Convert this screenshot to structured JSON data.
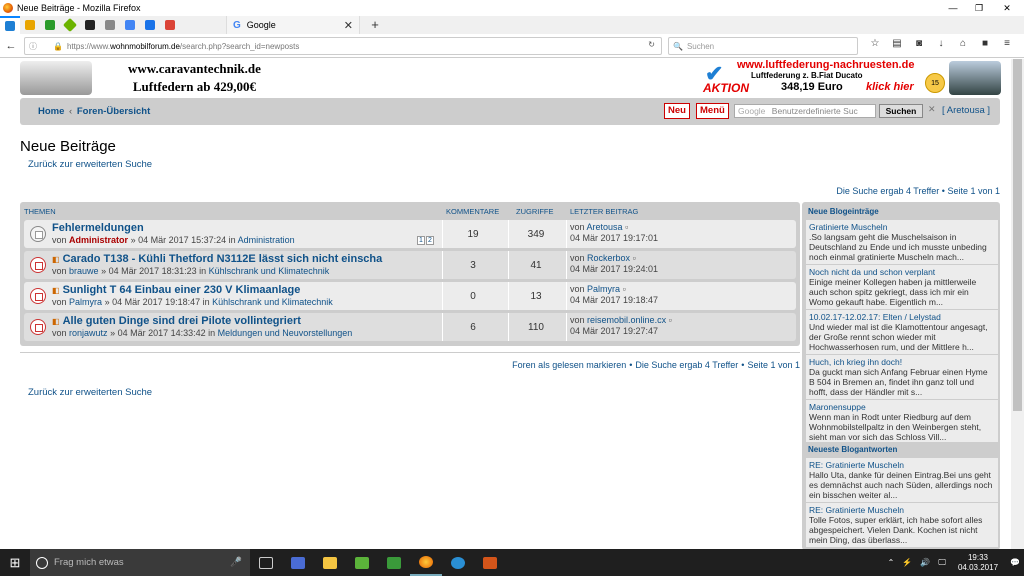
{
  "window": {
    "title": "Neue Beiträge - Mozilla Firefox",
    "min": "—",
    "max": "❐",
    "close": "✕"
  },
  "tabs": {
    "google_label": "Google",
    "google_icon": "G",
    "close": "✕",
    "new": "+"
  },
  "nav": {
    "back": "←",
    "info": "ⓘ",
    "lock": "🔒",
    "url_prefix": "https://www.",
    "url_domain": "wohnmobilforum.de",
    "url_path": "/search.php?search_id=newposts",
    "reload": "↻",
    "search_placeholder": "Suchen",
    "search_icon": "🔍",
    "toolbar_icons": [
      "☆",
      "▤",
      "◙",
      "↓",
      "⌂",
      "■",
      "≡"
    ]
  },
  "banner": {
    "left_line1": "www.caravantechnik.de",
    "left_line2": "Luftfedern ab 429,00€",
    "right_site": "www.luftfederung-nachruesten.de",
    "right_line2": "Luftfederung z. B.Fiat Ducato",
    "right_price": "348,19 Euro",
    "right_aktion": "AKTION",
    "right_klick": "klick hier",
    "right_badge": "15"
  },
  "forumnav": {
    "home": "Home",
    "sep": "‹",
    "overview": "Foren-Übersicht",
    "new_btn": "Neu",
    "menu_btn": "Menü",
    "search_google": "Google",
    "search_placeholder": "Benutzerdefinierte Suc",
    "search_btn": "Suchen",
    "clear": "✕",
    "user": "[ Aretousa ]"
  },
  "page": {
    "title": "Neue Beiträge",
    "back_link": "Zurück zur erweiterten Suche",
    "result_top": "Die Suche ergab 4 Treffer • Seite 1 von 1",
    "footer_mark": "Foren als gelesen markieren",
    "footer_dot": "•",
    "footer_result": "Die Suche ergab 4 Treffer",
    "footer_page": "Seite 1 von 1"
  },
  "table": {
    "headers": {
      "themen": "THEMEN",
      "kommentare": "KOMMENTARE",
      "zugriffe": "ZUGRIFFE",
      "letzter": "LETZTER BEITRAG"
    },
    "rows": [
      {
        "title": "Fehlermeldungen",
        "von": "von",
        "author": "Administrator",
        "date": "» 04 Mär 2017 15:37:24 in",
        "forum": "Administration",
        "pages": [
          "1",
          "2"
        ],
        "comments": "19",
        "views": "349",
        "last_von": "von",
        "last_author": "Aretousa",
        "last_date": "04 Mär 2017 19:17:01"
      },
      {
        "title": "Carado T138 - Kühli Thetford N3112E lässt sich nicht einscha",
        "von": "von",
        "author": "brauwe",
        "date": "» 04 Mär 2017 18:31:23 in",
        "forum": "Kühlschrank und Klimatechnik",
        "comments": "3",
        "views": "41",
        "last_von": "von",
        "last_author": "Rockerbox",
        "last_date": "04 Mär 2017 19:24:01"
      },
      {
        "title": "Sunlight T 64 Einbau einer 230 V Klimaanlage",
        "von": "von",
        "author": "Palmyra",
        "date": "» 04 Mär 2017 19:18:47 in",
        "forum": "Kühlschrank und Klimatechnik",
        "comments": "0",
        "views": "13",
        "last_von": "von",
        "last_author": "Palmyra",
        "last_date": "04 Mär 2017 19:18:47"
      },
      {
        "title": "Alle guten Dinge sind drei Pilote vollintegriert",
        "von": "von",
        "author": "ronjawutz",
        "date": "» 04 Mär 2017 14:33:42 in",
        "forum": "Meldungen und Neuvorstellungen",
        "comments": "6",
        "views": "110",
        "last_von": "von",
        "last_author": "reisemobil.online.cx",
        "last_date": "04 Mär 2017 19:27:47"
      }
    ]
  },
  "sidebar": {
    "blog_head": "Neue Blogeinträge",
    "answers_head": "Neueste Blogantworten",
    "blog": [
      {
        "title": "Gratinierte Muscheln",
        "body": ".So langsam geht die Muschelsaison in Deutschland zu Ende und ich musste unbeding noch einmal gratinierte Muscheln mach..."
      },
      {
        "title": "Noch nicht da und schon verplant",
        "body": "Einige meiner Kollegen haben ja mittlerweile auch schon spitz gekriegt, dass ich mir ein Womo gekauft habe. Eigentlich m..."
      },
      {
        "title": "10.02.17-12.02.17: Elten / Lelystad",
        "body": "Und wieder mal ist die Klamottentour angesagt, der Große rennt schon wieder mit Hochwasserhosen rum, und der Mittlere h..."
      },
      {
        "title": "Huch, ich krieg ihn doch!",
        "body": "Da guckt man sich Anfang Februar einen Hyme B 504 in Bremen an, findet ihn ganz toll und hofft, dass der Händler mit s..."
      },
      {
        "title": "Maronensuppe",
        "body": "Wenn man in Rodt unter Riedburg auf dem Wohnmobilstellpaltz in den Weinbergen steht, sieht man vor sich das Schloss Vill..."
      }
    ],
    "answers": [
      {
        "title": "RE: Gratinierte Muscheln",
        "body": "Hallo Uta, danke für deinen Eintrag.Bei uns geht es demnächst auch nach Süden, allerdings noch ein bisschen weiter al..."
      },
      {
        "title": "RE: Gratinierte Muscheln",
        "body": "Tolle Fotos, super erklärt, ich habe sofort alles abgespeichert. Vielen Dank. Kochen ist nicht mein Ding, das überlass..."
      }
    ]
  },
  "taskbar": {
    "start": "⊞",
    "search_placeholder": "Frag mich etwas",
    "mic": "🎤",
    "time": "19:33",
    "date": "04.03.2017",
    "tray": [
      "⌃",
      "⚡",
      "🔊",
      "🖵",
      "💬"
    ]
  }
}
